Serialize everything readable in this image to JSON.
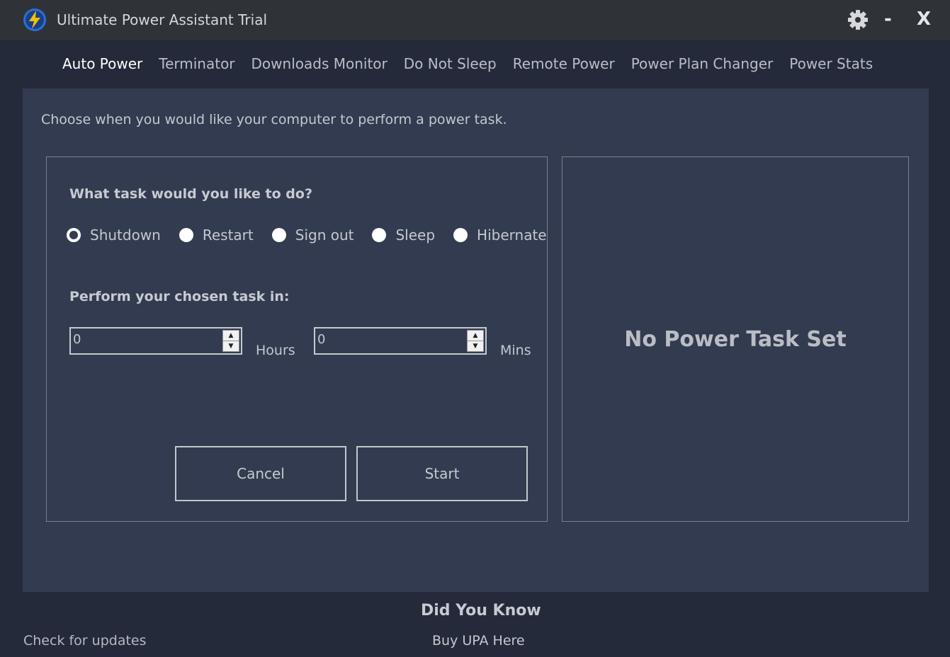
{
  "window": {
    "title": "Ultimate Power Assistant Trial",
    "minimize_label": "-",
    "close_label": "X"
  },
  "tabs": [
    {
      "label": "Auto Power",
      "active": true
    },
    {
      "label": "Terminator",
      "active": false
    },
    {
      "label": "Downloads Monitor",
      "active": false
    },
    {
      "label": "Do Not Sleep",
      "active": false
    },
    {
      "label": "Remote Power",
      "active": false
    },
    {
      "label": "Power Plan Changer",
      "active": false
    },
    {
      "label": "Power Stats",
      "active": false
    }
  ],
  "main": {
    "intro": "Choose when you would like your computer to perform a power task.",
    "task_question": "What task would you like to do?",
    "tasks": [
      {
        "label": "Shutdown",
        "selected": true
      },
      {
        "label": "Restart",
        "selected": false
      },
      {
        "label": "Sign out",
        "selected": false
      },
      {
        "label": "Sleep",
        "selected": false
      },
      {
        "label": "Hibernate",
        "selected": false
      }
    ],
    "time_question": "Perform your chosen task in:",
    "hours": {
      "value": "0",
      "unit": "Hours"
    },
    "mins": {
      "value": "0",
      "unit": "Mins"
    },
    "cancel_label": "Cancel",
    "start_label": "Start",
    "status": "No Power Task Set"
  },
  "footer": {
    "did_you_know": "Did You Know",
    "check_updates": "Check for updates",
    "buy": "Buy UPA Here"
  },
  "colors": {
    "titlebar": "#2f3338",
    "background": "#242a3a",
    "panel": "#333b50",
    "accent_icon": "#f2c200"
  },
  "icons": [
    "lightning-bolt-icon",
    "gear-icon"
  ]
}
